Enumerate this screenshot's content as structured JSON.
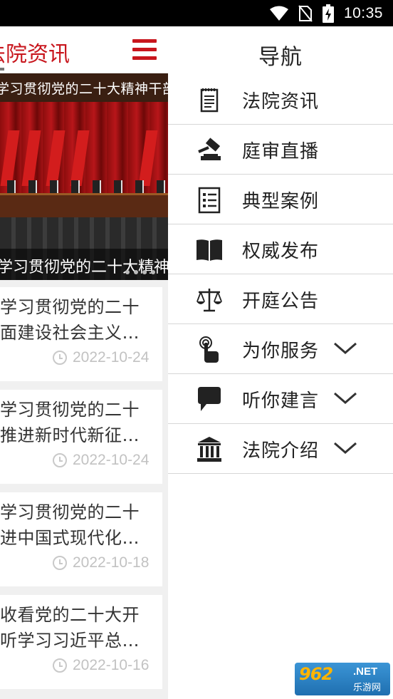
{
  "status_bar": {
    "time": "10:35",
    "icons": [
      "wifi-icon",
      "no-sim-icon",
      "battery-charging-icon"
    ]
  },
  "page": {
    "title": "法院资讯",
    "banner": {
      "heading": "学习贯彻党的二十大精神干部大会",
      "caption": "学习贯彻党的二十大精神 …"
    },
    "news": [
      {
        "line1": "学习贯彻党的二十",
        "line2": "面建设社会主义…",
        "date": "2022-10-24"
      },
      {
        "line1": "学习贯彻党的二十",
        "line2": "推进新时代新征…",
        "date": "2022-10-24"
      },
      {
        "line1": "学习贯彻党的二十",
        "line2": "进中国式现代化…",
        "date": "2022-10-18"
      },
      {
        "line1": "收看党的二十大开",
        "line2": "听学习习近平总…",
        "date": "2022-10-16"
      }
    ]
  },
  "drawer": {
    "title": "导航",
    "items": [
      {
        "label": "法院资讯",
        "icon": "newspaper-icon",
        "expandable": false
      },
      {
        "label": "庭审直播",
        "icon": "gavel-icon",
        "expandable": false
      },
      {
        "label": "典型案例",
        "icon": "list-document-icon",
        "expandable": false
      },
      {
        "label": "权威发布",
        "icon": "open-book-icon",
        "expandable": false
      },
      {
        "label": "开庭公告",
        "icon": "scales-icon",
        "expandable": false
      },
      {
        "label": "为你服务",
        "icon": "touch-hand-icon",
        "expandable": true
      },
      {
        "label": "听你建言",
        "icon": "speech-bubble-icon",
        "expandable": true
      },
      {
        "label": "法院介绍",
        "icon": "courthouse-icon",
        "expandable": true
      }
    ]
  },
  "watermark": {
    "number": "962",
    "net": ".NET",
    "site": "乐游网"
  },
  "colors": {
    "accent_red": "#c8161d",
    "divider": "#d6d6d6",
    "date_gray": "#c2c2c2"
  }
}
